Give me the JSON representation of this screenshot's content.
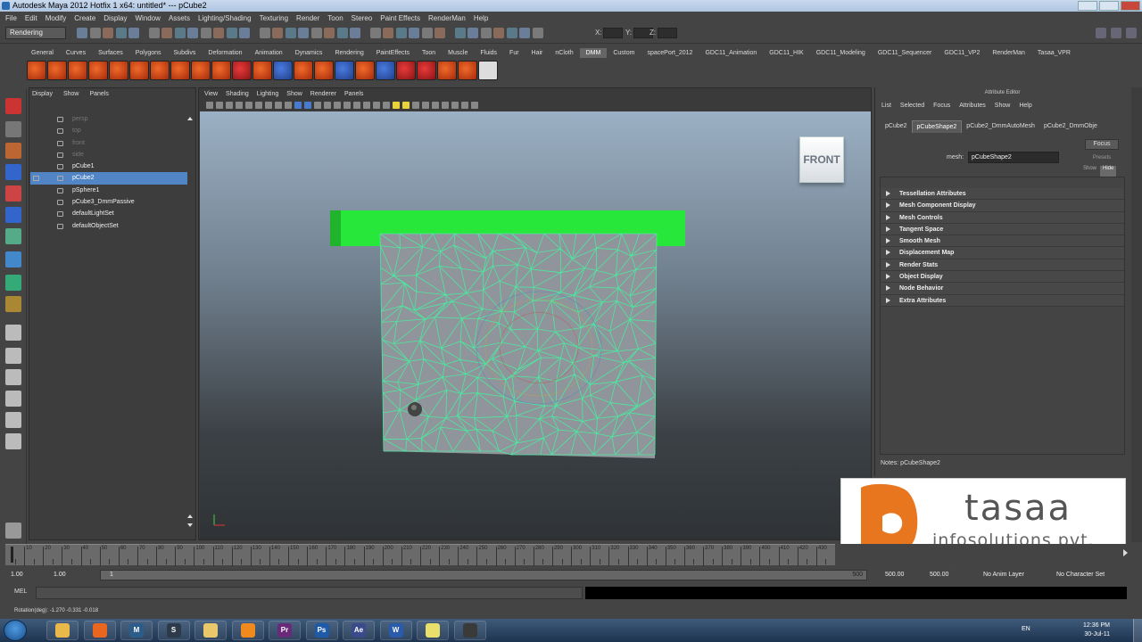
{
  "window": {
    "title": "Autodesk Maya 2012 Hotfix 1 x64: untitled*   ---   pCube2"
  },
  "menubar": [
    "File",
    "Edit",
    "Modify",
    "Create",
    "Display",
    "Window",
    "Assets",
    "Lighting/Shading",
    "Texturing",
    "Render",
    "Toon",
    "Stereo",
    "Paint Effects",
    "RenderMan",
    "Help"
  ],
  "statusline": {
    "mode": "Rendering",
    "x_label": "X:",
    "y_label": "Y:",
    "z_label": "Z:"
  },
  "shelf": {
    "tabs": [
      "General",
      "Curves",
      "Surfaces",
      "Polygons",
      "Subdivs",
      "Deformation",
      "Animation",
      "Dynamics",
      "Rendering",
      "PaintEffects",
      "Toon",
      "Muscle",
      "Fluids",
      "Fur",
      "Hair",
      "nCloth",
      "DMM",
      "Custom",
      "spacePort_2012",
      "GDC11_Animation",
      "GDC11_HIK",
      "GDC11_Modeling",
      "GDC11_Sequencer",
      "GDC11_VP2",
      "RenderMan",
      "Tasaa_VPR"
    ],
    "active_tab": "DMM"
  },
  "outliner": {
    "menu": [
      "Display",
      "Show",
      "Panels"
    ],
    "items": [
      {
        "label": "persp",
        "dim": true,
        "selected": false
      },
      {
        "label": "top",
        "dim": true,
        "selected": false
      },
      {
        "label": "front",
        "dim": true,
        "selected": false
      },
      {
        "label": "side",
        "dim": true,
        "selected": false
      },
      {
        "label": "pCube1",
        "dim": false,
        "selected": false
      },
      {
        "label": "pCube2",
        "dim": false,
        "selected": true
      },
      {
        "label": "pSphere1",
        "dim": false,
        "selected": false
      },
      {
        "label": "pCube3_DmmPassive",
        "dim": false,
        "selected": false
      },
      {
        "label": "defaultLightSet",
        "dim": false,
        "selected": false
      },
      {
        "label": "defaultObjectSet",
        "dim": false,
        "selected": false
      }
    ]
  },
  "viewport": {
    "menu": [
      "View",
      "Shading",
      "Lighting",
      "Show",
      "Renderer",
      "Panels"
    ],
    "view_cube_label": "FRONT",
    "colors": {
      "wireframe": "#4de8a0",
      "top_plank": "#27e83a",
      "mesh_fill": "#8f959a"
    }
  },
  "attribute_editor": {
    "title": "Attribute Editor",
    "menu": [
      "List",
      "Selected",
      "Focus",
      "Attributes",
      "Show",
      "Help"
    ],
    "tabs": [
      "pCube2",
      "pCubeShape2",
      "pCube2_DmmAutoMesh",
      "pCube2_DmmObje"
    ],
    "active_tab": "pCubeShape2",
    "focus_label": "Focus",
    "presets_label": "Presets",
    "show_label": "Show",
    "hide_label": "Hide",
    "mesh_label": "mesh:",
    "mesh_value": "pCubeShape2",
    "sections": [
      "Tessellation Attributes",
      "Mesh Component Display",
      "Mesh Controls",
      "Tangent Space",
      "Smooth Mesh",
      "Displacement Map",
      "Render Stats",
      "Object Display",
      "Node Behavior",
      "Extra Attributes"
    ],
    "notes": "Notes: pCubeShape2"
  },
  "logo": {
    "name": "tasaa",
    "tagline": "infosolutions pvt. ltd.",
    "brand_color": "#e8761e"
  },
  "timeline": {
    "ticks": [
      5,
      10,
      15,
      20,
      25,
      30,
      35,
      40,
      45,
      50,
      55,
      60,
      65,
      70,
      75,
      80,
      85,
      90,
      95,
      100,
      105,
      110,
      115,
      120,
      125,
      130,
      135,
      140,
      145,
      150,
      155,
      160,
      165,
      170,
      175,
      180,
      185,
      190,
      195,
      200,
      205,
      210,
      215,
      220,
      225,
      230,
      235,
      240,
      245,
      250,
      255,
      260,
      265,
      270,
      275,
      280,
      285,
      290,
      295,
      300,
      305,
      310,
      315,
      320,
      325,
      330,
      335,
      340,
      345,
      350,
      355,
      360,
      365,
      370,
      375,
      380,
      385,
      390,
      395,
      400,
      405,
      410,
      415,
      420,
      425,
      430,
      435
    ],
    "labels": [
      10,
      20,
      30,
      40,
      50,
      60,
      70,
      80,
      90,
      100,
      110,
      120,
      130,
      140,
      150,
      160,
      170,
      180,
      190,
      200,
      210,
      220,
      230,
      240,
      250,
      260,
      270,
      280,
      290,
      300,
      310,
      320,
      330,
      340,
      350,
      360,
      370,
      380,
      390,
      400,
      410,
      420,
      430
    ]
  },
  "range": {
    "start_time": "1.00",
    "playback_start": "1.00",
    "range_start": "1",
    "range_end": "500",
    "playback_end": "500.00",
    "end_time": "500.00",
    "anim_layer": "No Anim Layer",
    "character_set": "No Character Set"
  },
  "commandline": {
    "label": "MEL"
  },
  "helpline": {
    "text": "Rotation(deg):   -1.270    -0.331    -0.018"
  },
  "taskbar": {
    "apps": [
      {
        "name": "explorer-icon",
        "glyph": "",
        "color": "#e8b84a"
      },
      {
        "name": "firefox-icon",
        "glyph": "",
        "color": "#e8661e"
      },
      {
        "name": "maya-icon",
        "glyph": "M",
        "color": "#2c5c8a"
      },
      {
        "name": "app-s-icon",
        "glyph": "S",
        "color": "#2d3a4a"
      },
      {
        "name": "folder-icon",
        "glyph": "",
        "color": "#e8c86a"
      },
      {
        "name": "vlc-icon",
        "glyph": "",
        "color": "#f08a1e"
      },
      {
        "name": "premiere-icon",
        "glyph": "Pr",
        "color": "#6a2a7a"
      },
      {
        "name": "photoshop-icon",
        "glyph": "Ps",
        "color": "#1e5aa8"
      },
      {
        "name": "aftereffects-icon",
        "glyph": "Ae",
        "color": "#3a4a8a"
      },
      {
        "name": "word-icon",
        "glyph": "W",
        "color": "#2a5aaa"
      },
      {
        "name": "notes-icon",
        "glyph": "",
        "color": "#e8e06a"
      },
      {
        "name": "tool-icon",
        "glyph": "",
        "color": "#3a3a3a"
      }
    ],
    "language": "EN",
    "time": "12:36 PM",
    "date": "30-Jul-11"
  }
}
